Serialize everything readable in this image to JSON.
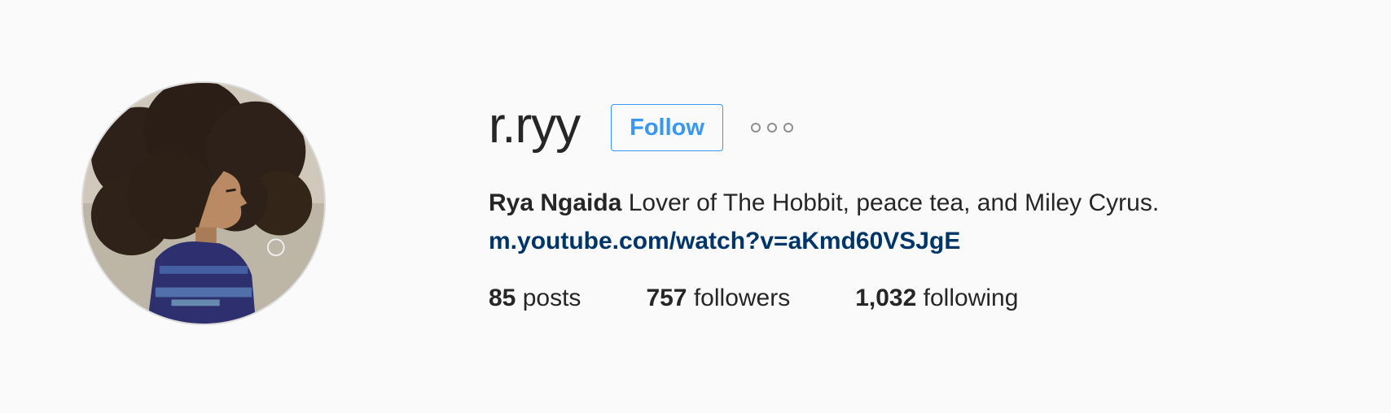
{
  "profile": {
    "username": "r.ryy",
    "follow_label": "Follow",
    "more_icon": "ellipsis-icon",
    "full_name": "Rya Ngaida",
    "bio": "Lover of The Hobbit, peace tea, and Miley Cyrus.",
    "link": "m.youtube.com/watch?v=aKmd60VSJgE",
    "stats": [
      {
        "count": "85",
        "label": "posts"
      },
      {
        "count": "757",
        "label": "followers"
      },
      {
        "count": "1,032",
        "label": "following"
      }
    ]
  },
  "colors": {
    "accent": "#3897f0",
    "link": "#003569",
    "text": "#262626",
    "background": "#fafafa"
  }
}
